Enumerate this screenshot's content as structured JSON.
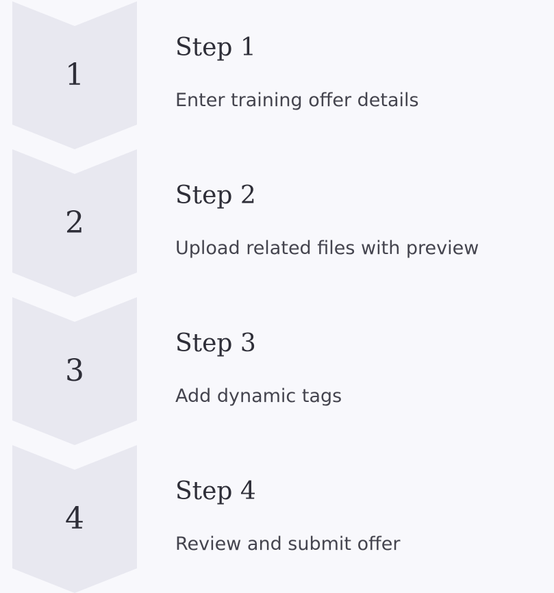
{
  "colors": {
    "background": "#f8f8fc",
    "chevron_fill": "#e8e8f0",
    "heading_text": "#2e2e38",
    "body_text": "#44444e"
  },
  "steps": [
    {
      "number": "1",
      "title": "Step 1",
      "description": "Enter training offer details"
    },
    {
      "number": "2",
      "title": "Step 2",
      "description": "Upload related files with preview"
    },
    {
      "number": "3",
      "title": "Step 3",
      "description": "Add dynamic tags"
    },
    {
      "number": "4",
      "title": "Step 4",
      "description": "Review and submit offer"
    }
  ]
}
